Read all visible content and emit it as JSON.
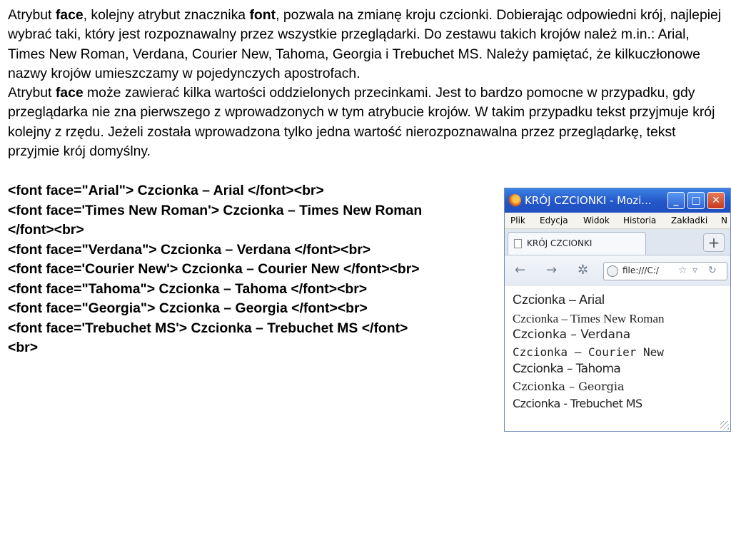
{
  "paragraph1": {
    "t1": "Atrybut ",
    "b1": "face",
    "t2": ", kolejny atrybut znacznika ",
    "b2": "font",
    "t3": ", pozwala na zmianę kroju czcionki. Dobierając odpowiedni krój, najlepiej wybrać taki, który jest rozpoznawalny przez wszystkie przeglądarki. Do zestawu takich krojów należ m.in.: Arial, Times New Roman, Verdana, Courier New, Tahoma, Georgia i Trebuchet MS. Należy pamiętać, że kilkuczłonowe nazwy krojów umieszczamy w pojedynczych apostrofach."
  },
  "paragraph2": {
    "t1": "Atrybut ",
    "b1": "face",
    "t2": " może zawierać kilka wartości oddzielonych przecinkami. Jest to bardzo pomocne w przypadku, gdy przeglądarka nie zna pierwszego z wprowadzonych w tym atrybucie krojów. W takim przypadku tekst przyjmuje krój kolejny z rzędu. Jeżeli została wprowadzona tylko jedna wartość nierozpoznawalna przez przeglądarkę, tekst przyjmie krój domyślny."
  },
  "code_lines": [
    "<font face=\"Arial\"> Czcionka – Arial </font><br>",
    "<font face='Times New Roman'> Czcionka – Times New Roman",
    "</font><br>",
    "<font face=\"Verdana\"> Czcionka – Verdana </font><br>",
    "<font face='Courier New'> Czcionka – Courier New </font><br>",
    "<font face=\"Tahoma\"> Czcionka – Tahoma </font><br>",
    "<font face=\"Georgia\"> Czcionka – Georgia </font><br>",
    "<font face='Trebuchet MS'> Czcionka – Trebuchet MS </font>",
    "<br>"
  ],
  "browser": {
    "title": "KRÓJ CZCIONKI - Mozi...",
    "buttons": {
      "minimize": "_",
      "maximize": "□",
      "close": "✕"
    },
    "menu": [
      "Plik",
      "Edycja",
      "Widok",
      "Historia",
      "Zakładki",
      "N"
    ],
    "tab_label": "KRÓJ CZCIONKI",
    "new_tab": "+",
    "nav": {
      "back": "←",
      "forward": "→",
      "reload": "↻"
    },
    "url": "file:///C:/",
    "samples": [
      "Czcionka – Arial",
      "Czcionka – Times New Roman",
      "Czcionka – Verdana",
      "Czcionka – Courier New",
      "Czcionka – Tahoma",
      "Czcionka – Georgia",
      "Czcionka - Trebuchet MS"
    ]
  }
}
